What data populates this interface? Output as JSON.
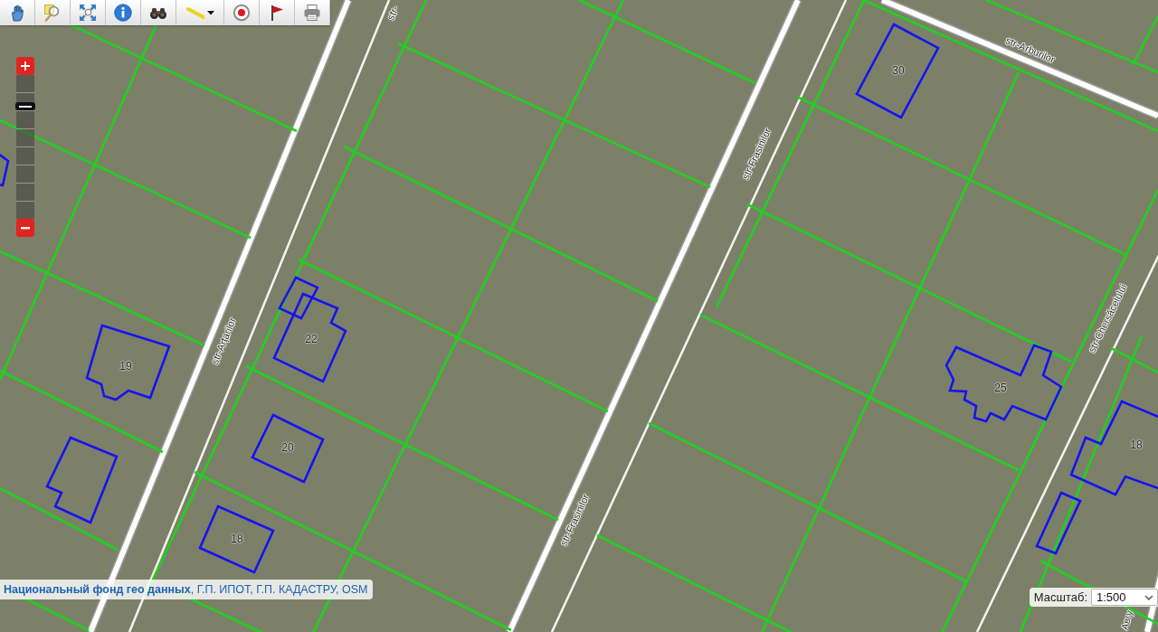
{
  "toolbar": {
    "buttons": [
      {
        "kind": "pan",
        "dropdown": false
      },
      {
        "kind": "zoom-box",
        "dropdown": false
      },
      {
        "kind": "full-extent",
        "dropdown": false
      },
      {
        "kind": "info",
        "dropdown": false
      },
      {
        "kind": "search",
        "dropdown": false
      },
      {
        "kind": "measure",
        "dropdown": true
      },
      {
        "kind": "record",
        "dropdown": false
      },
      {
        "kind": "flag",
        "dropdown": false
      },
      {
        "kind": "print",
        "dropdown": false
      }
    ]
  },
  "zoom_control": {
    "level": 0.8
  },
  "map": {
    "streets": [
      {
        "name": "str-"
      },
      {
        "name": "str-Arțarilor"
      },
      {
        "name": "str-Frasinilor"
      },
      {
        "name": "str-Frasinilor"
      },
      {
        "name": "str-Arburilor"
      },
      {
        "name": "str-Chersăcelului"
      },
      {
        "name": "Авгу"
      }
    ],
    "buildings": [
      {
        "number": "30"
      },
      {
        "number": "22"
      },
      {
        "number": "19"
      },
      {
        "number": "20"
      },
      {
        "number": "18"
      },
      {
        "number": "25"
      },
      {
        "number": "18"
      }
    ]
  },
  "attribution": {
    "text": "**Национальный фонд гео данных**, Г.П. ИПОТ, Г.П. КАДАСТРУ, OSM"
  },
  "scale": {
    "label": "Масштаб:",
    "value": "1:500"
  }
}
